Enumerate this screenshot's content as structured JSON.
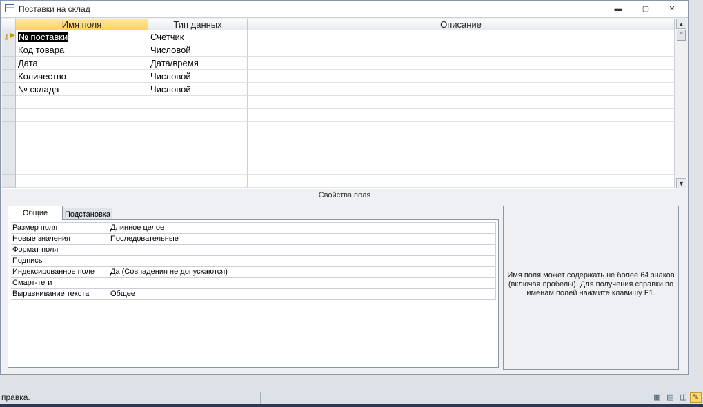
{
  "window": {
    "title": "Поставки на склад",
    "minimize": "▬",
    "restore": "▢",
    "close": "✕"
  },
  "grid": {
    "headers": [
      "Имя поля",
      "Тип данных",
      "Описание"
    ],
    "rows": [
      {
        "name": "№ поставки",
        "type": "Счетчик",
        "desc": ""
      },
      {
        "name": "Код товара",
        "type": "Числовой",
        "desc": ""
      },
      {
        "name": "Дата",
        "type": "Дата/время",
        "desc": ""
      },
      {
        "name": "Количество",
        "type": "Числовой",
        "desc": ""
      },
      {
        "name": "№ склада",
        "type": "Числовой",
        "desc": ""
      }
    ]
  },
  "props_section_title": "Свойства поля",
  "tabs": {
    "general": "Общие",
    "lookup": "Подстановка"
  },
  "properties": [
    {
      "name": "Размер поля",
      "value": "Длинное целое"
    },
    {
      "name": "Новые значения",
      "value": "Последовательные"
    },
    {
      "name": "Формат поля",
      "value": ""
    },
    {
      "name": "Подпись",
      "value": ""
    },
    {
      "name": "Индексированное поле",
      "value": "Да (Совпадения не допускаются)"
    },
    {
      "name": "Смарт-теги",
      "value": ""
    },
    {
      "name": "Выравнивание текста",
      "value": "Общее"
    }
  ],
  "help_text": "Имя поля может содержать не более 64 знаков (включая пробелы). Для получения справки по именам полей нажмите клавишу F1.",
  "status": {
    "text": "правка."
  },
  "icons": {
    "primary_key": "key-icon",
    "current_row": "arrow-icon",
    "views": [
      "datasheet-view-icon",
      "pivottable-view-icon",
      "pivotchart-view-icon",
      "design-view-icon"
    ]
  }
}
